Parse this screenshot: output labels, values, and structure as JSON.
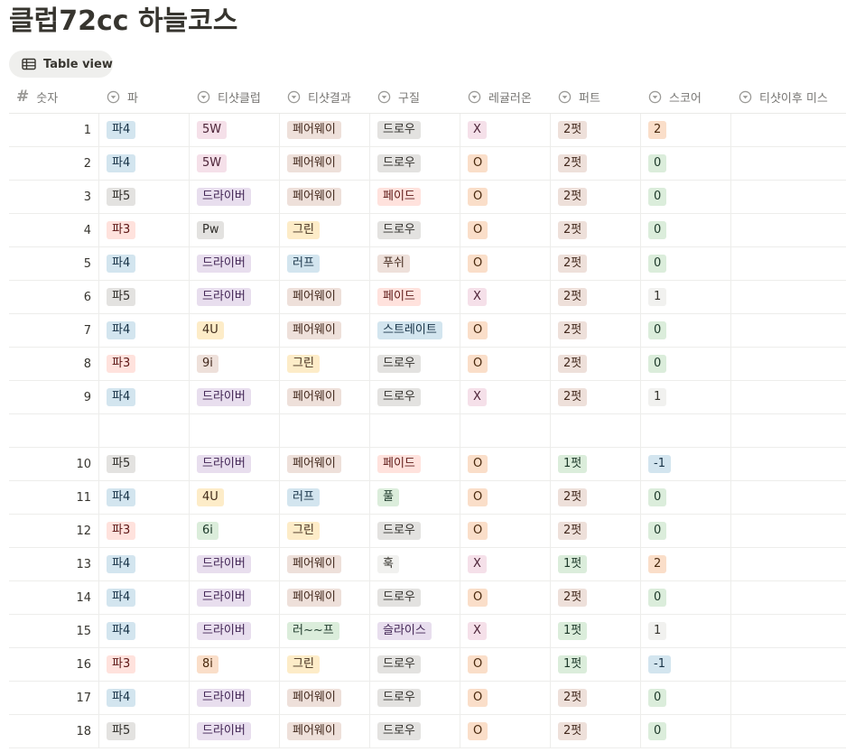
{
  "page": {
    "title": "클럽72cc 하늘코스"
  },
  "view": {
    "label": "Table view"
  },
  "columns": [
    {
      "label": "숫자",
      "icon": "number-icon"
    },
    {
      "label": "파",
      "icon": "select-icon"
    },
    {
      "label": "티샷클럽",
      "icon": "select-icon"
    },
    {
      "label": "티샷결과",
      "icon": "select-icon"
    },
    {
      "label": "구질",
      "icon": "select-icon"
    },
    {
      "label": "레귤러온",
      "icon": "select-icon"
    },
    {
      "label": "퍼트",
      "icon": "select-icon"
    },
    {
      "label": "스코어",
      "icon": "select-icon"
    },
    {
      "label": "티샷이후 미스",
      "icon": "select-icon"
    }
  ],
  "rows": [
    {
      "num": "1",
      "cells": [
        {
          "t": "파4",
          "c": "blue"
        },
        {
          "t": "5W",
          "c": "pink"
        },
        {
          "t": "페어웨이",
          "c": "brown"
        },
        {
          "t": "드로우",
          "c": "gray"
        },
        {
          "t": "X",
          "c": "pink"
        },
        {
          "t": "2펏",
          "c": "brown"
        },
        {
          "t": "2",
          "c": "orange"
        },
        {
          "t": "",
          "c": ""
        }
      ]
    },
    {
      "num": "2",
      "cells": [
        {
          "t": "파4",
          "c": "blue"
        },
        {
          "t": "5W",
          "c": "pink"
        },
        {
          "t": "페어웨이",
          "c": "brown"
        },
        {
          "t": "드로우",
          "c": "gray"
        },
        {
          "t": "O",
          "c": "orange"
        },
        {
          "t": "2펏",
          "c": "brown"
        },
        {
          "t": "0",
          "c": "green"
        },
        {
          "t": "",
          "c": ""
        }
      ]
    },
    {
      "num": "3",
      "cells": [
        {
          "t": "파5",
          "c": "gray"
        },
        {
          "t": "드라이버",
          "c": "purple"
        },
        {
          "t": "페어웨이",
          "c": "brown"
        },
        {
          "t": "페이드",
          "c": "red"
        },
        {
          "t": "O",
          "c": "orange"
        },
        {
          "t": "2펏",
          "c": "brown"
        },
        {
          "t": "0",
          "c": "green"
        },
        {
          "t": "",
          "c": ""
        }
      ]
    },
    {
      "num": "4",
      "cells": [
        {
          "t": "파3",
          "c": "red"
        },
        {
          "t": "Pw",
          "c": "gray"
        },
        {
          "t": "그린",
          "c": "yellow"
        },
        {
          "t": "드로우",
          "c": "gray"
        },
        {
          "t": "O",
          "c": "orange"
        },
        {
          "t": "2펏",
          "c": "brown"
        },
        {
          "t": "0",
          "c": "green"
        },
        {
          "t": "",
          "c": ""
        }
      ]
    },
    {
      "num": "5",
      "cells": [
        {
          "t": "파4",
          "c": "blue"
        },
        {
          "t": "드라이버",
          "c": "purple"
        },
        {
          "t": "러프",
          "c": "blue"
        },
        {
          "t": "푸쉬",
          "c": "brown"
        },
        {
          "t": "O",
          "c": "orange"
        },
        {
          "t": "2펏",
          "c": "brown"
        },
        {
          "t": "0",
          "c": "green"
        },
        {
          "t": "",
          "c": ""
        }
      ]
    },
    {
      "num": "6",
      "cells": [
        {
          "t": "파5",
          "c": "gray"
        },
        {
          "t": "드라이버",
          "c": "purple"
        },
        {
          "t": "페어웨이",
          "c": "brown"
        },
        {
          "t": "페이드",
          "c": "red"
        },
        {
          "t": "X",
          "c": "pink"
        },
        {
          "t": "2펏",
          "c": "brown"
        },
        {
          "t": "1",
          "c": "default"
        },
        {
          "t": "",
          "c": ""
        }
      ]
    },
    {
      "num": "7",
      "cells": [
        {
          "t": "파4",
          "c": "blue"
        },
        {
          "t": "4U",
          "c": "yellow"
        },
        {
          "t": "페어웨이",
          "c": "brown"
        },
        {
          "t": "스트레이트",
          "c": "blue"
        },
        {
          "t": "O",
          "c": "orange"
        },
        {
          "t": "2펏",
          "c": "brown"
        },
        {
          "t": "0",
          "c": "green"
        },
        {
          "t": "",
          "c": ""
        }
      ]
    },
    {
      "num": "8",
      "cells": [
        {
          "t": "파3",
          "c": "red"
        },
        {
          "t": "9i",
          "c": "brown"
        },
        {
          "t": "그린",
          "c": "yellow"
        },
        {
          "t": "드로우",
          "c": "gray"
        },
        {
          "t": "O",
          "c": "orange"
        },
        {
          "t": "2펏",
          "c": "brown"
        },
        {
          "t": "0",
          "c": "green"
        },
        {
          "t": "",
          "c": ""
        }
      ]
    },
    {
      "num": "9",
      "cells": [
        {
          "t": "파4",
          "c": "blue"
        },
        {
          "t": "드라이버",
          "c": "purple"
        },
        {
          "t": "페어웨이",
          "c": "brown"
        },
        {
          "t": "드로우",
          "c": "gray"
        },
        {
          "t": "X",
          "c": "pink"
        },
        {
          "t": "2펏",
          "c": "brown"
        },
        {
          "t": "1",
          "c": "default"
        },
        {
          "t": "",
          "c": ""
        }
      ]
    },
    {
      "num": "",
      "cells": [
        {
          "t": "",
          "c": ""
        },
        {
          "t": "",
          "c": ""
        },
        {
          "t": "",
          "c": ""
        },
        {
          "t": "",
          "c": ""
        },
        {
          "t": "",
          "c": ""
        },
        {
          "t": "",
          "c": ""
        },
        {
          "t": "",
          "c": ""
        },
        {
          "t": "",
          "c": ""
        }
      ]
    },
    {
      "num": "10",
      "cells": [
        {
          "t": "파5",
          "c": "gray"
        },
        {
          "t": "드라이버",
          "c": "purple"
        },
        {
          "t": "페어웨이",
          "c": "brown"
        },
        {
          "t": "페이드",
          "c": "red"
        },
        {
          "t": "O",
          "c": "orange"
        },
        {
          "t": "1펏",
          "c": "green"
        },
        {
          "t": "-1",
          "c": "blue"
        },
        {
          "t": "",
          "c": ""
        }
      ]
    },
    {
      "num": "11",
      "cells": [
        {
          "t": "파4",
          "c": "blue"
        },
        {
          "t": "4U",
          "c": "yellow"
        },
        {
          "t": "러프",
          "c": "blue"
        },
        {
          "t": "풀",
          "c": "green"
        },
        {
          "t": "O",
          "c": "orange"
        },
        {
          "t": "2펏",
          "c": "brown"
        },
        {
          "t": "0",
          "c": "green"
        },
        {
          "t": "",
          "c": ""
        }
      ]
    },
    {
      "num": "12",
      "cells": [
        {
          "t": "파3",
          "c": "red"
        },
        {
          "t": "6i",
          "c": "green"
        },
        {
          "t": "그린",
          "c": "yellow"
        },
        {
          "t": "드로우",
          "c": "gray"
        },
        {
          "t": "O",
          "c": "orange"
        },
        {
          "t": "2펏",
          "c": "brown"
        },
        {
          "t": "0",
          "c": "green"
        },
        {
          "t": "",
          "c": ""
        }
      ]
    },
    {
      "num": "13",
      "cells": [
        {
          "t": "파4",
          "c": "blue"
        },
        {
          "t": "드라이버",
          "c": "purple"
        },
        {
          "t": "페어웨이",
          "c": "brown"
        },
        {
          "t": "훅",
          "c": "default"
        },
        {
          "t": "X",
          "c": "pink"
        },
        {
          "t": "1펏",
          "c": "green"
        },
        {
          "t": "2",
          "c": "orange"
        },
        {
          "t": "",
          "c": ""
        }
      ]
    },
    {
      "num": "14",
      "cells": [
        {
          "t": "파4",
          "c": "blue"
        },
        {
          "t": "드라이버",
          "c": "purple"
        },
        {
          "t": "페어웨이",
          "c": "brown"
        },
        {
          "t": "드로우",
          "c": "gray"
        },
        {
          "t": "O",
          "c": "orange"
        },
        {
          "t": "2펏",
          "c": "brown"
        },
        {
          "t": "0",
          "c": "green"
        },
        {
          "t": "",
          "c": ""
        }
      ]
    },
    {
      "num": "15",
      "cells": [
        {
          "t": "파4",
          "c": "blue"
        },
        {
          "t": "드라이버",
          "c": "purple"
        },
        {
          "t": "러~~프",
          "c": "green"
        },
        {
          "t": "슬라이스",
          "c": "purple"
        },
        {
          "t": "X",
          "c": "pink"
        },
        {
          "t": "1펏",
          "c": "green"
        },
        {
          "t": "1",
          "c": "default"
        },
        {
          "t": "",
          "c": ""
        }
      ]
    },
    {
      "num": "16",
      "cells": [
        {
          "t": "파3",
          "c": "red"
        },
        {
          "t": "8i",
          "c": "orange"
        },
        {
          "t": "그린",
          "c": "yellow"
        },
        {
          "t": "드로우",
          "c": "gray"
        },
        {
          "t": "O",
          "c": "orange"
        },
        {
          "t": "1펏",
          "c": "green"
        },
        {
          "t": "-1",
          "c": "blue"
        },
        {
          "t": "",
          "c": ""
        }
      ]
    },
    {
      "num": "17",
      "cells": [
        {
          "t": "파4",
          "c": "blue"
        },
        {
          "t": "드라이버",
          "c": "purple"
        },
        {
          "t": "페어웨이",
          "c": "brown"
        },
        {
          "t": "드로우",
          "c": "gray"
        },
        {
          "t": "O",
          "c": "orange"
        },
        {
          "t": "2펏",
          "c": "brown"
        },
        {
          "t": "0",
          "c": "green"
        },
        {
          "t": "",
          "c": ""
        }
      ]
    },
    {
      "num": "18",
      "cells": [
        {
          "t": "파5",
          "c": "gray"
        },
        {
          "t": "드라이버",
          "c": "purple"
        },
        {
          "t": "페어웨이",
          "c": "brown"
        },
        {
          "t": "드로우",
          "c": "gray"
        },
        {
          "t": "O",
          "c": "orange"
        },
        {
          "t": "2펏",
          "c": "brown"
        },
        {
          "t": "0",
          "c": "green"
        },
        {
          "t": "",
          "c": ""
        }
      ]
    }
  ],
  "colors": {
    "blue": "#d3e5ef",
    "gray": "#e3e2e0",
    "red": "#ffe2dd",
    "pink": "#f5e0e9",
    "purple": "#e8deee",
    "brown": "#eee0da",
    "yellow": "#fdecc8",
    "green": "#dbeddb",
    "orange": "#fadec9",
    "default": "#f1f1ef"
  }
}
